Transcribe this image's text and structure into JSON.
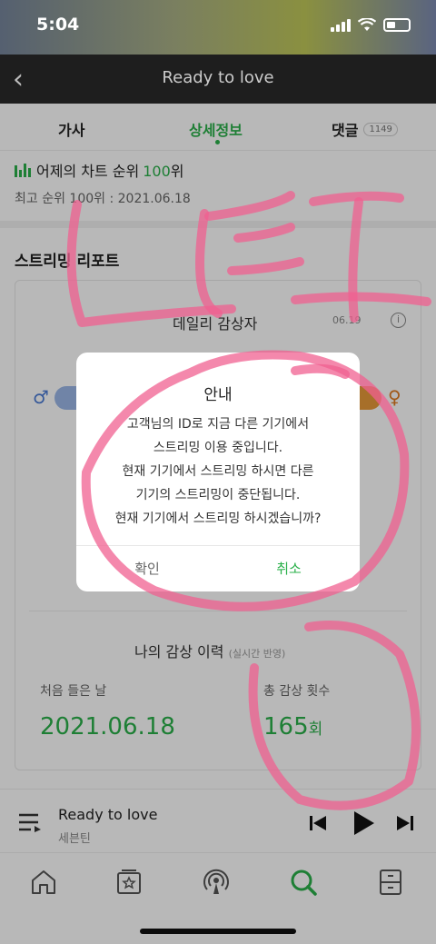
{
  "status_bar": {
    "time": "5:04"
  },
  "nav": {
    "title": "Ready to love"
  },
  "tabs": {
    "lyrics": "가사",
    "detail": "상세정보",
    "comments": "댓글",
    "comment_count": "1149"
  },
  "chart": {
    "rank_prefix": "어제의 차트 순위",
    "rank_value": "100",
    "rank_suffix": "위",
    "best_rank": "최고 순위 100위 : 2021.06.18"
  },
  "report": {
    "section_title": "스트리밍 리포트",
    "daily_title": "데일리 감상자",
    "daily_date": "06.19",
    "history_title": "나의 감상 이력",
    "history_sub": "(실시간 반영)",
    "first_label": "처음 들은 날",
    "first_value": "2021.06.18",
    "count_label": "총 감상 횟수",
    "count_value": "165",
    "count_unit": "회"
  },
  "player": {
    "song": "Ready to love",
    "artist": "세븐틴"
  },
  "dialog": {
    "title": "안내",
    "lines": [
      "고객님의 ID로 지금 다른 기기에서",
      "스트리밍 이용 중입니다.",
      "현재 기기에서 스트리밍 하시면 다른",
      "기기의 스트리밍이 중단됩니다.",
      "현재 기기에서 스트리밍 하시겠습니까?"
    ],
    "confirm": "확인",
    "cancel": "취소"
  },
  "colors": {
    "accent": "#2ab04a",
    "nav_bg": "#1e1e1e",
    "scribble": "#f06090"
  },
  "icons": [
    "back-icon",
    "wifi-icon",
    "battery-icon",
    "chart-bars-icon",
    "info-icon",
    "male-icon",
    "female-icon",
    "playlist-icon",
    "prev-icon",
    "play-icon",
    "next-icon",
    "home-icon",
    "library-icon",
    "podcast-icon",
    "search-icon",
    "storage-icon"
  ]
}
